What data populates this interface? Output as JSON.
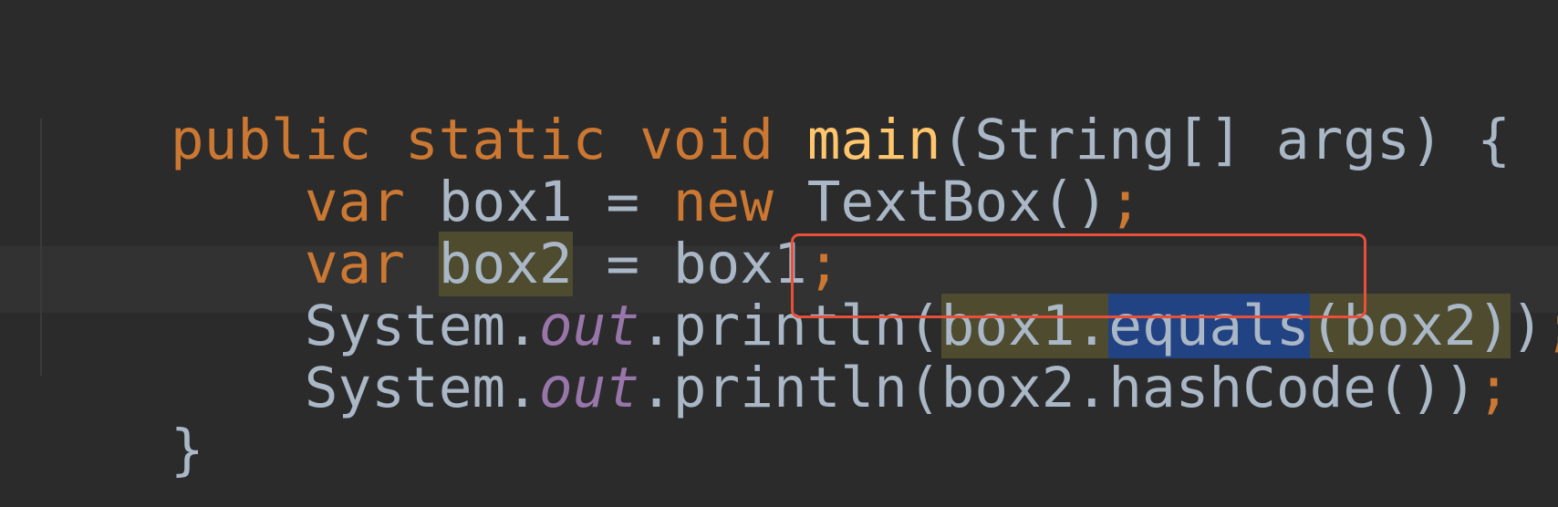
{
  "editor": {
    "colors": {
      "background": "#2b2b2b",
      "keyword": "#cc7832",
      "method_declaration": "#ffc66d",
      "identifier": "#a9b7c6",
      "static_field": "#9876aa",
      "identifier_highlight": "#4e4b2f",
      "selection": "#214283",
      "annotation_box": "#e8503a"
    },
    "lines": [
      {
        "tokens": [
          {
            "text": "public",
            "kind": "keyword"
          },
          {
            "text": " "
          },
          {
            "text": "static",
            "kind": "keyword"
          },
          {
            "text": " "
          },
          {
            "text": "void",
            "kind": "keyword"
          },
          {
            "text": " "
          },
          {
            "text": "main",
            "kind": "method"
          },
          {
            "text": "(String[] args) {"
          }
        ]
      },
      {
        "tokens": [
          {
            "text": "    "
          },
          {
            "text": "var",
            "kind": "keyword"
          },
          {
            "text": " box1 = "
          },
          {
            "text": "new",
            "kind": "keyword"
          },
          {
            "text": " TextBox()"
          },
          {
            "text": ";",
            "kind": "keyword"
          }
        ]
      },
      {
        "tokens": [
          {
            "text": "    "
          },
          {
            "text": "var",
            "kind": "keyword"
          },
          {
            "text": " "
          },
          {
            "text": "box2",
            "kind": "highlighted"
          },
          {
            "text": " = box1"
          },
          {
            "text": ";",
            "kind": "keyword"
          }
        ]
      },
      {
        "tokens": [
          {
            "text": "    System."
          },
          {
            "text": "out",
            "kind": "static-field"
          },
          {
            "text": ".println("
          },
          {
            "text": "box1.",
            "kind": "highlighted"
          },
          {
            "text": "equals",
            "kind": "selected"
          },
          {
            "text": "(box2)",
            "kind": "highlighted"
          },
          {
            "text": ")"
          },
          {
            "text": ";",
            "kind": "keyword"
          }
        ]
      },
      {
        "tokens": [
          {
            "text": "    System."
          },
          {
            "text": "out",
            "kind": "static-field"
          },
          {
            "text": ".println(box2.hashCode())"
          },
          {
            "text": ";",
            "kind": "keyword"
          }
        ]
      },
      {
        "tokens": [
          {
            "text": "}"
          }
        ]
      }
    ]
  }
}
